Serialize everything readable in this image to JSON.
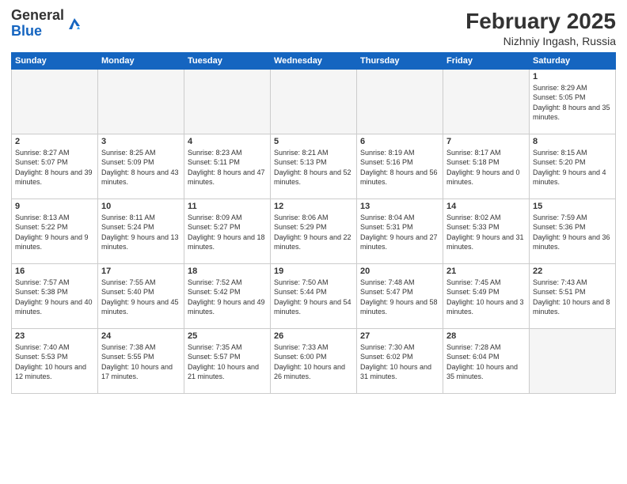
{
  "header": {
    "logo_general": "General",
    "logo_blue": "Blue",
    "title": "February 2025",
    "subtitle": "Nizhniy Ingash, Russia"
  },
  "calendar": {
    "weekdays": [
      "Sunday",
      "Monday",
      "Tuesday",
      "Wednesday",
      "Thursday",
      "Friday",
      "Saturday"
    ],
    "weeks": [
      [
        {
          "day": "",
          "info": "",
          "empty": true
        },
        {
          "day": "",
          "info": "",
          "empty": true
        },
        {
          "day": "",
          "info": "",
          "empty": true
        },
        {
          "day": "",
          "info": "",
          "empty": true
        },
        {
          "day": "",
          "info": "",
          "empty": true
        },
        {
          "day": "",
          "info": "",
          "empty": true
        },
        {
          "day": "1",
          "info": "Sunrise: 8:29 AM\nSunset: 5:05 PM\nDaylight: 8 hours and 35 minutes."
        }
      ],
      [
        {
          "day": "2",
          "info": "Sunrise: 8:27 AM\nSunset: 5:07 PM\nDaylight: 8 hours and 39 minutes."
        },
        {
          "day": "3",
          "info": "Sunrise: 8:25 AM\nSunset: 5:09 PM\nDaylight: 8 hours and 43 minutes."
        },
        {
          "day": "4",
          "info": "Sunrise: 8:23 AM\nSunset: 5:11 PM\nDaylight: 8 hours and 47 minutes."
        },
        {
          "day": "5",
          "info": "Sunrise: 8:21 AM\nSunset: 5:13 PM\nDaylight: 8 hours and 52 minutes."
        },
        {
          "day": "6",
          "info": "Sunrise: 8:19 AM\nSunset: 5:16 PM\nDaylight: 8 hours and 56 minutes."
        },
        {
          "day": "7",
          "info": "Sunrise: 8:17 AM\nSunset: 5:18 PM\nDaylight: 9 hours and 0 minutes."
        },
        {
          "day": "8",
          "info": "Sunrise: 8:15 AM\nSunset: 5:20 PM\nDaylight: 9 hours and 4 minutes."
        }
      ],
      [
        {
          "day": "9",
          "info": "Sunrise: 8:13 AM\nSunset: 5:22 PM\nDaylight: 9 hours and 9 minutes."
        },
        {
          "day": "10",
          "info": "Sunrise: 8:11 AM\nSunset: 5:24 PM\nDaylight: 9 hours and 13 minutes."
        },
        {
          "day": "11",
          "info": "Sunrise: 8:09 AM\nSunset: 5:27 PM\nDaylight: 9 hours and 18 minutes."
        },
        {
          "day": "12",
          "info": "Sunrise: 8:06 AM\nSunset: 5:29 PM\nDaylight: 9 hours and 22 minutes."
        },
        {
          "day": "13",
          "info": "Sunrise: 8:04 AM\nSunset: 5:31 PM\nDaylight: 9 hours and 27 minutes."
        },
        {
          "day": "14",
          "info": "Sunrise: 8:02 AM\nSunset: 5:33 PM\nDaylight: 9 hours and 31 minutes."
        },
        {
          "day": "15",
          "info": "Sunrise: 7:59 AM\nSunset: 5:36 PM\nDaylight: 9 hours and 36 minutes."
        }
      ],
      [
        {
          "day": "16",
          "info": "Sunrise: 7:57 AM\nSunset: 5:38 PM\nDaylight: 9 hours and 40 minutes."
        },
        {
          "day": "17",
          "info": "Sunrise: 7:55 AM\nSunset: 5:40 PM\nDaylight: 9 hours and 45 minutes."
        },
        {
          "day": "18",
          "info": "Sunrise: 7:52 AM\nSunset: 5:42 PM\nDaylight: 9 hours and 49 minutes."
        },
        {
          "day": "19",
          "info": "Sunrise: 7:50 AM\nSunset: 5:44 PM\nDaylight: 9 hours and 54 minutes."
        },
        {
          "day": "20",
          "info": "Sunrise: 7:48 AM\nSunset: 5:47 PM\nDaylight: 9 hours and 58 minutes."
        },
        {
          "day": "21",
          "info": "Sunrise: 7:45 AM\nSunset: 5:49 PM\nDaylight: 10 hours and 3 minutes."
        },
        {
          "day": "22",
          "info": "Sunrise: 7:43 AM\nSunset: 5:51 PM\nDaylight: 10 hours and 8 minutes."
        }
      ],
      [
        {
          "day": "23",
          "info": "Sunrise: 7:40 AM\nSunset: 5:53 PM\nDaylight: 10 hours and 12 minutes."
        },
        {
          "day": "24",
          "info": "Sunrise: 7:38 AM\nSunset: 5:55 PM\nDaylight: 10 hours and 17 minutes."
        },
        {
          "day": "25",
          "info": "Sunrise: 7:35 AM\nSunset: 5:57 PM\nDaylight: 10 hours and 21 minutes."
        },
        {
          "day": "26",
          "info": "Sunrise: 7:33 AM\nSunset: 6:00 PM\nDaylight: 10 hours and 26 minutes."
        },
        {
          "day": "27",
          "info": "Sunrise: 7:30 AM\nSunset: 6:02 PM\nDaylight: 10 hours and 31 minutes."
        },
        {
          "day": "28",
          "info": "Sunrise: 7:28 AM\nSunset: 6:04 PM\nDaylight: 10 hours and 35 minutes."
        },
        {
          "day": "",
          "info": "",
          "empty": true
        }
      ]
    ]
  }
}
